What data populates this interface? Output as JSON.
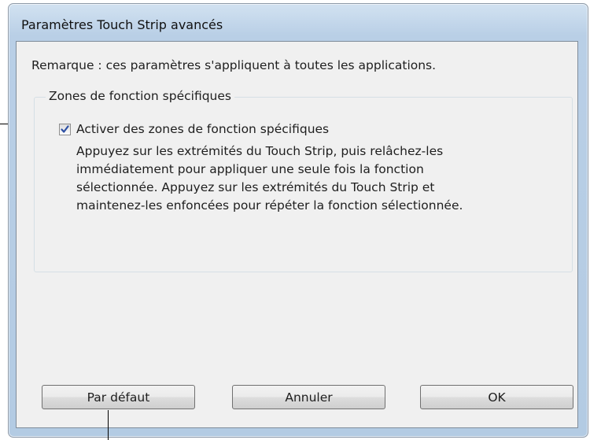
{
  "dialog": {
    "title": "Paramètres Touch Strip avancés",
    "note": "Remarque : ces paramètres s'appliquent à toutes les applications.",
    "group": {
      "title": "Zones de fonction spécifiques",
      "checkbox": {
        "label": "Activer des zones de fonction spécifiques",
        "checked": true
      },
      "description_lines": [
        "Appuyez sur les extrémités du Touch Strip, puis relâchez-les",
        "immédiatement pour appliquer une seule fois la fonction",
        "sélectionnée. Appuyez sur les extrémités du Touch Strip et",
        "maintenez-les enfoncées pour répéter la fonction sélectionnée."
      ]
    },
    "buttons": {
      "default": "Par défaut",
      "cancel": "Annuler",
      "ok": "OK"
    }
  },
  "colors": {
    "frame": "#b9cfe6",
    "client": "#f0f0f0",
    "check_accent": "#2c4fa3"
  },
  "icons": {
    "checkmark": "checkmark-icon"
  }
}
